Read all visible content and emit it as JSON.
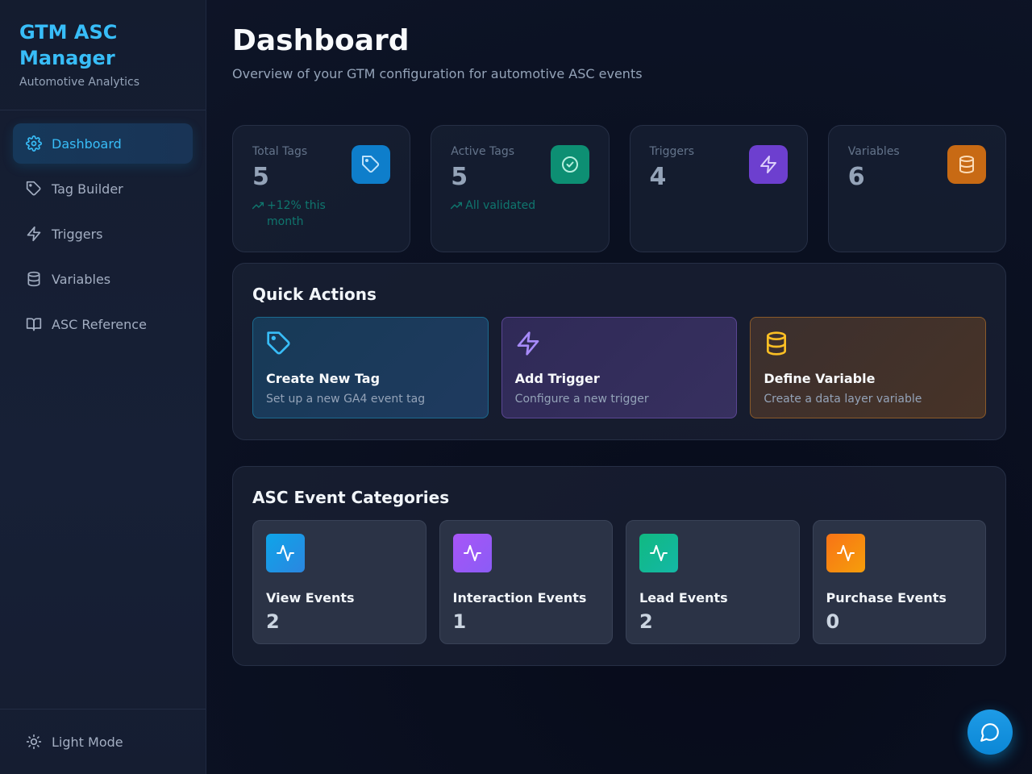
{
  "sidebar": {
    "brand_title": "GTM ASC Manager",
    "brand_subtitle": "Automotive Analytics",
    "items": [
      {
        "label": "Dashboard",
        "icon": "gear-icon",
        "active": true
      },
      {
        "label": "Tag Builder",
        "icon": "tag-icon",
        "active": false
      },
      {
        "label": "Triggers",
        "icon": "lightning-icon",
        "active": false
      },
      {
        "label": "Variables",
        "icon": "database-icon",
        "active": false
      },
      {
        "label": "ASC Reference",
        "icon": "book-icon",
        "active": false
      }
    ],
    "footer_label": "Light Mode",
    "footer_icon": "sun-icon"
  },
  "header": {
    "title": "Dashboard",
    "subtitle": "Overview of your GTM configuration for automotive ASC events"
  },
  "stats": [
    {
      "label": "Total Tags",
      "value": "5",
      "trend": "+12% this month",
      "icon": "tag-icon",
      "color": "#0e7ecb"
    },
    {
      "label": "Active Tags",
      "value": "5",
      "trend": "All validated",
      "icon": "check-circle-icon",
      "color": "#0d8f73"
    },
    {
      "label": "Triggers",
      "value": "4",
      "icon": "lightning-icon",
      "color": "#6d3fcf"
    },
    {
      "label": "Variables",
      "value": "6",
      "icon": "database-icon",
      "color": "#c86a14"
    }
  ],
  "quick_actions": {
    "title": "Quick Actions",
    "items": [
      {
        "title": "Create New Tag",
        "desc": "Set up a new GA4 event tag",
        "icon": "tag-icon",
        "color": "#38bdf8"
      },
      {
        "title": "Add Trigger",
        "desc": "Configure a new trigger",
        "icon": "lightning-icon",
        "color": "#a78bfa"
      },
      {
        "title": "Define Variable",
        "desc": "Create a data layer variable",
        "icon": "database-icon",
        "color": "#fbbf24"
      }
    ]
  },
  "categories": {
    "title": "ASC Event Categories",
    "items": [
      {
        "name": "View Events",
        "count": "2",
        "icon": "activity-icon",
        "color": "#1e9be6"
      },
      {
        "name": "Interaction Events",
        "count": "1",
        "icon": "activity-icon",
        "color": "#9d5cf0"
      },
      {
        "name": "Lead Events",
        "count": "2",
        "icon": "activity-icon",
        "color": "#14b88f"
      },
      {
        "name": "Purchase Events",
        "count": "0",
        "icon": "activity-icon",
        "color": "#f7860f"
      }
    ]
  },
  "chat_button_icon": "chat-bubble-icon"
}
